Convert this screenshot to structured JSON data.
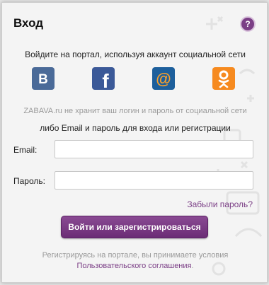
{
  "dialog": {
    "title": "Вход",
    "help_symbol": "?",
    "subtitle": "Войдите на портал, используя аккаунт социальной сети",
    "social": [
      {
        "name": "vk",
        "icon": "vk-icon",
        "glyph": "B",
        "color": "#4a6a98"
      },
      {
        "name": "facebook",
        "icon": "facebook-icon",
        "glyph": "f",
        "color": "#3b5998"
      },
      {
        "name": "mail",
        "icon": "mail-ru-icon",
        "glyph": "@",
        "color": "#1d5f9c"
      },
      {
        "name": "odnoklassniki",
        "icon": "odnoklassniki-icon",
        "glyph": "ok",
        "color": "#f68a1f"
      }
    ],
    "note": "ZABAVA.ru не хранит ваш логин и пароль от социальной сети",
    "alt_text": "либо Email и пароль для входа или регистрации",
    "email_label": "Email:",
    "email_value": "",
    "password_label": "Пароль:",
    "password_value": "",
    "forgot_link": "Забыли пароль?",
    "submit_label": "Войти или зарегистрироваться",
    "terms_text": "Регистрируясь на портале, вы принимаете условия",
    "terms_link": "Пользовательского соглашения",
    "terms_end": "."
  },
  "colors": {
    "accent": "#7b3f86",
    "background": "#f4f4f4"
  }
}
